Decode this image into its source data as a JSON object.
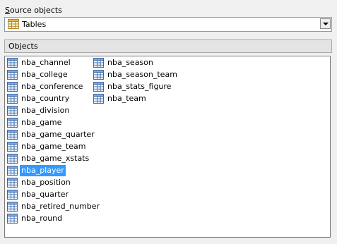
{
  "source": {
    "label_accel": "S",
    "label_rest": "ource objects",
    "selected_value": "Tables",
    "icon": "table-icon"
  },
  "objects_panel": {
    "title": "Objects"
  },
  "objects": {
    "column1": [
      {
        "name": "nba_channel",
        "selected": false
      },
      {
        "name": "nba_college",
        "selected": false
      },
      {
        "name": "nba_conference",
        "selected": false
      },
      {
        "name": "nba_country",
        "selected": false
      },
      {
        "name": "nba_division",
        "selected": false
      },
      {
        "name": "nba_game",
        "selected": false
      },
      {
        "name": "nba_game_quarter",
        "selected": false
      },
      {
        "name": "nba_game_team",
        "selected": false
      },
      {
        "name": "nba_game_xstats",
        "selected": false
      },
      {
        "name": "nba_player",
        "selected": true
      },
      {
        "name": "nba_position",
        "selected": false
      },
      {
        "name": "nba_quarter",
        "selected": false
      },
      {
        "name": "nba_retired_number",
        "selected": false
      },
      {
        "name": "nba_round",
        "selected": false
      }
    ],
    "column2": [
      {
        "name": "nba_season",
        "selected": false
      },
      {
        "name": "nba_season_team",
        "selected": false
      },
      {
        "name": "nba_stats_figure",
        "selected": false
      },
      {
        "name": "nba_team",
        "selected": false
      }
    ],
    "item_icon": "table-icon"
  },
  "colors": {
    "selection_bg": "#3399ff",
    "selection_text": "#ffffff",
    "table_icon_blue": "#4a7ab8"
  }
}
